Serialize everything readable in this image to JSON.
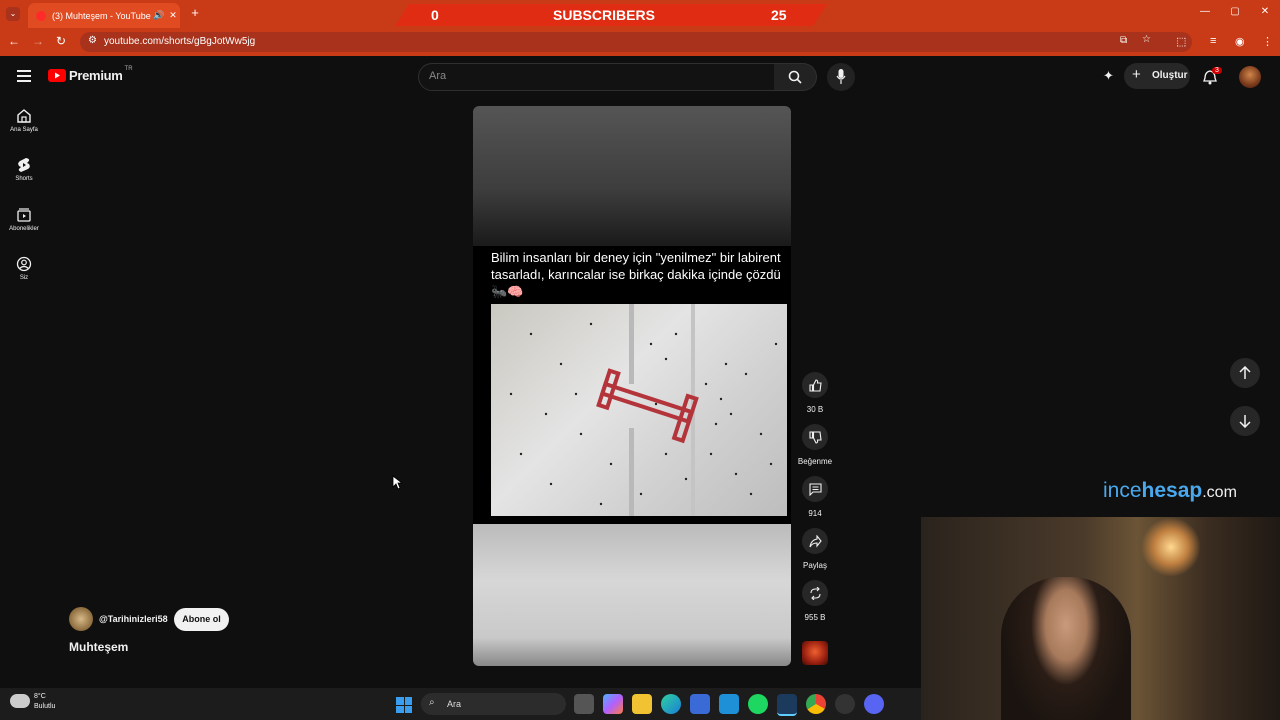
{
  "browser": {
    "tab_title": "(3) Muhteşem - YouTube",
    "url": "youtube.com/shorts/gBgJotWw5jg"
  },
  "overlay": {
    "subscribers_label": "SUBSCRIBERS",
    "left_count": "0",
    "right_count": "25"
  },
  "youtube": {
    "logo_text": "Premium",
    "logo_badge": "TR",
    "search_placeholder": "Ara",
    "create_label": "Oluştur",
    "notification_count": "3"
  },
  "sidebar": {
    "items": [
      {
        "label": "Ana Sayfa",
        "icon": "home-icon"
      },
      {
        "label": "Shorts",
        "icon": "shorts-icon"
      },
      {
        "label": "Abonelikler",
        "icon": "subscriptions-icon"
      },
      {
        "label": "Siz",
        "icon": "account-icon"
      }
    ]
  },
  "short": {
    "caption": "Bilim insanları bir deney için \"yenilmez\" bir labirent tasarladı, karıncalar ise birkaç dakika içinde çözdü 🐜🧠",
    "channel": "@Tarihinizleri58",
    "subscribe_label": "Abone ol",
    "title": "Muhteşem",
    "likes": "30 B",
    "dislike_label": "Beğenme",
    "comments": "914",
    "share_label": "Paylaş",
    "remix": "955 B"
  },
  "watermark": {
    "part1": "ince",
    "part2": "hesap",
    "part3": ".com"
  },
  "taskbar": {
    "weather_temp": "8°C",
    "weather_desc": "Bulutlu",
    "search_label": "Ara"
  },
  "colors": {
    "chrome_bar": "#c93b16",
    "youtube_red": "#ff0000",
    "watermark_blue": "#3aa0e8"
  }
}
